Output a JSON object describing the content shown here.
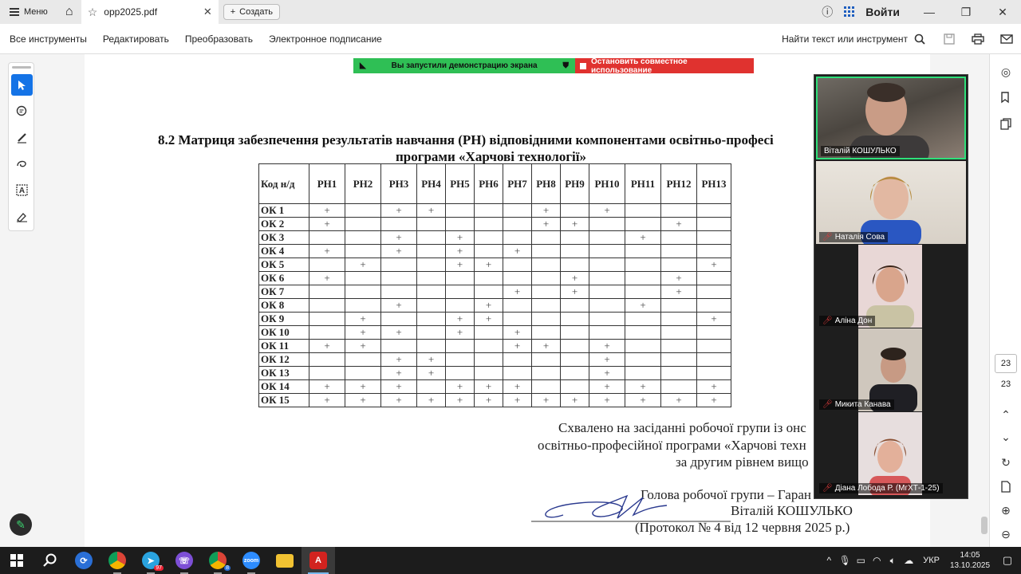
{
  "titlebar": {
    "menu_label": "Меню",
    "tab_name": "opp2025.pdf",
    "create_label": "Создать",
    "login_label": "Войти"
  },
  "toolbar": {
    "items": [
      "Все инструменты",
      "Редактировать",
      "Преобразовать",
      "Электронное подписание"
    ],
    "find_label": "Найти текст или инструмент"
  },
  "share_banner": {
    "green_label": "Вы запустили демонстрацию экрана",
    "red_label": "Остановить совместное использование",
    "green_color": "#2fbf55",
    "red_color": "#e0322f"
  },
  "document": {
    "title_line1": "8.2 Матриця забезпечення результатів навчання (РН) відповідними компонентами освітньо-професі",
    "title_line2": "програми «Харчові технології»",
    "table": {
      "corner": "Код н/д",
      "columns": [
        "РН1",
        "РН2",
        "РН3",
        "РН4",
        "РН5",
        "РН6",
        "РН7",
        "РН8",
        "РН9",
        "РН10",
        "РН11",
        "РН12",
        "РН13"
      ],
      "rows": [
        {
          "code": "ОК 1",
          "marks": [
            1,
            0,
            1,
            1,
            0,
            0,
            0,
            1,
            0,
            1,
            0,
            0,
            0
          ]
        },
        {
          "code": "ОК 2",
          "marks": [
            1,
            0,
            0,
            0,
            0,
            0,
            0,
            1,
            1,
            0,
            0,
            1,
            0
          ]
        },
        {
          "code": "ОК 3",
          "marks": [
            0,
            0,
            1,
            0,
            1,
            0,
            0,
            0,
            0,
            0,
            1,
            0,
            0
          ]
        },
        {
          "code": "ОК 4",
          "marks": [
            1,
            0,
            1,
            0,
            1,
            0,
            1,
            0,
            0,
            0,
            0,
            0,
            0
          ]
        },
        {
          "code": "ОК 5",
          "marks": [
            0,
            1,
            0,
            0,
            1,
            1,
            0,
            0,
            0,
            0,
            0,
            0,
            1
          ]
        },
        {
          "code": "ОК 6",
          "marks": [
            1,
            0,
            0,
            0,
            0,
            0,
            0,
            0,
            1,
            0,
            0,
            1,
            0
          ]
        },
        {
          "code": "ОК 7",
          "marks": [
            0,
            0,
            0,
            0,
            0,
            0,
            1,
            0,
            1,
            0,
            0,
            1,
            0
          ]
        },
        {
          "code": "ОК 8",
          "marks": [
            0,
            0,
            1,
            0,
            0,
            1,
            0,
            0,
            0,
            0,
            1,
            0,
            0
          ]
        },
        {
          "code": "ОК 9",
          "marks": [
            0,
            1,
            0,
            0,
            1,
            1,
            0,
            0,
            0,
            0,
            0,
            0,
            1
          ]
        },
        {
          "code": "ОК 10",
          "marks": [
            0,
            1,
            1,
            0,
            1,
            0,
            1,
            0,
            0,
            0,
            0,
            0,
            0
          ]
        },
        {
          "code": "ОК 11",
          "marks": [
            1,
            1,
            0,
            0,
            0,
            0,
            1,
            1,
            0,
            1,
            0,
            0,
            0
          ]
        },
        {
          "code": "ОК 12",
          "marks": [
            0,
            0,
            1,
            1,
            0,
            0,
            0,
            0,
            0,
            1,
            0,
            0,
            0
          ]
        },
        {
          "code": "ОК 13",
          "marks": [
            0,
            0,
            1,
            1,
            0,
            0,
            0,
            0,
            0,
            1,
            0,
            0,
            0
          ]
        },
        {
          "code": "ОК 14",
          "marks": [
            1,
            1,
            1,
            0,
            1,
            1,
            1,
            0,
            0,
            1,
            1,
            0,
            1
          ]
        },
        {
          "code": "ОК 15",
          "marks": [
            1,
            1,
            1,
            1,
            1,
            1,
            1,
            1,
            1,
            1,
            1,
            1,
            1
          ]
        }
      ],
      "mark_symbol": "+"
    },
    "footer_lines": [
      "Схвалено на засіданні робочої групи із онс",
      "освітньо-професійної програми «Харчові техн",
      "за другим рівнем вищо",
      "Голова робочої групи – Гаран",
      "Віталій КОШУЛЬКО",
      "(Протокол № 4 від 12 червня 2025 р.)"
    ]
  },
  "video_panel": {
    "participants": [
      {
        "name": "Віталій КОШУЛЬКО",
        "muted": false,
        "active": true
      },
      {
        "name": "Наталія Сова",
        "muted": true,
        "active": false
      },
      {
        "name": "Аліна Дон",
        "muted": true,
        "active": false
      },
      {
        "name": "Микита Канава",
        "muted": true,
        "active": false
      },
      {
        "name": "Діана Лобода Р. (МгХТ-1-25)",
        "muted": true,
        "active": false
      }
    ]
  },
  "rightbar": {
    "page_current": "23",
    "page_total": "23"
  },
  "taskbar": {
    "apps": [
      "start-icon",
      "search-icon",
      "app-icon",
      "chrome-icon",
      "telegram-icon",
      "viber-icon",
      "chrome-icon",
      "zoom-icon",
      "explorer-icon",
      "acrobat-icon"
    ],
    "telegram_badge": "97",
    "chrome2_badge": "8",
    "lang": "УКР",
    "time": "14:05",
    "date": "13.10.2025"
  }
}
